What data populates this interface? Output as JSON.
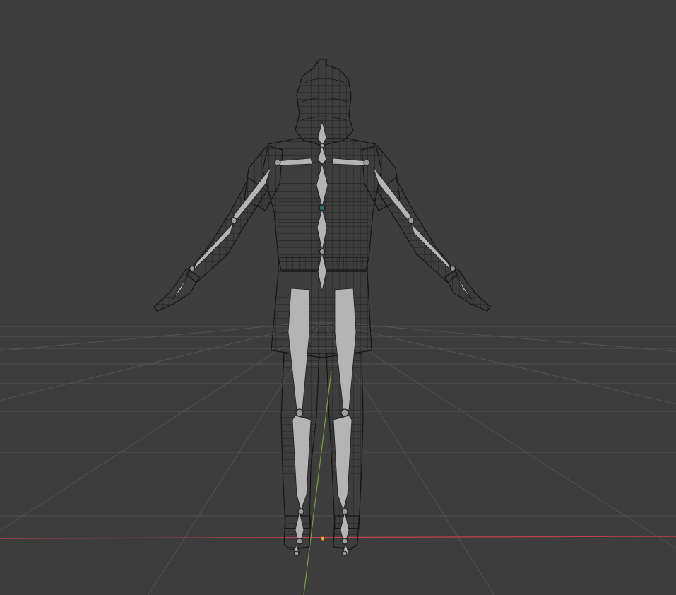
{
  "viewport": {
    "mode": "wireframe",
    "background_color": "#3d3d3d",
    "grid_color": "#545454",
    "x_axis_color": "#c0414e",
    "y_axis_color": "#7a9d3c",
    "wire_color": "#151515",
    "bone_color": "#b4b4b4",
    "origin_color": "#f0a030"
  },
  "scene": {
    "mesh": "armored-humanoid-wireframe",
    "armature": "humanoid-armature",
    "pose": "T-pose"
  }
}
